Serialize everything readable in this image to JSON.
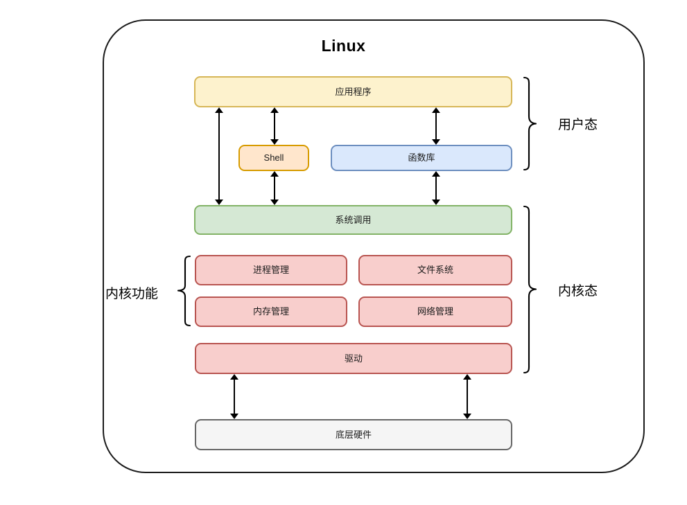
{
  "diagram": {
    "title": "Linux",
    "type": "architecture-layer-diagram",
    "layers": {
      "application": {
        "label": "应用程序"
      },
      "shell": {
        "label": "Shell"
      },
      "library": {
        "label": "函数库"
      },
      "syscall": {
        "label": "系统调用"
      },
      "kernel_modules": [
        {
          "label": "进程管理"
        },
        {
          "label": "文件系统"
        },
        {
          "label": "内存管理"
        },
        {
          "label": "网络管理"
        }
      ],
      "driver": {
        "label": "驱动"
      },
      "hardware": {
        "label": "底层硬件"
      }
    },
    "annotations": {
      "user_mode": "用户态",
      "kernel_mode": "内核态",
      "kernel_functions": "内核功能"
    },
    "colors": {
      "application_fill": "#fdf2cd",
      "application_stroke": "#d6b656",
      "shell_fill": "#ffe6cc",
      "shell_stroke": "#d79b00",
      "library_fill": "#dae8fc",
      "library_stroke": "#6c8ebf",
      "syscall_fill": "#d5e8d4",
      "syscall_stroke": "#82b366",
      "kernel_fill": "#f8cecc",
      "kernel_stroke": "#b85450",
      "hardware_fill": "#f5f5f5",
      "hardware_stroke": "#666666",
      "frame_stroke": "#1a1a1a"
    }
  }
}
